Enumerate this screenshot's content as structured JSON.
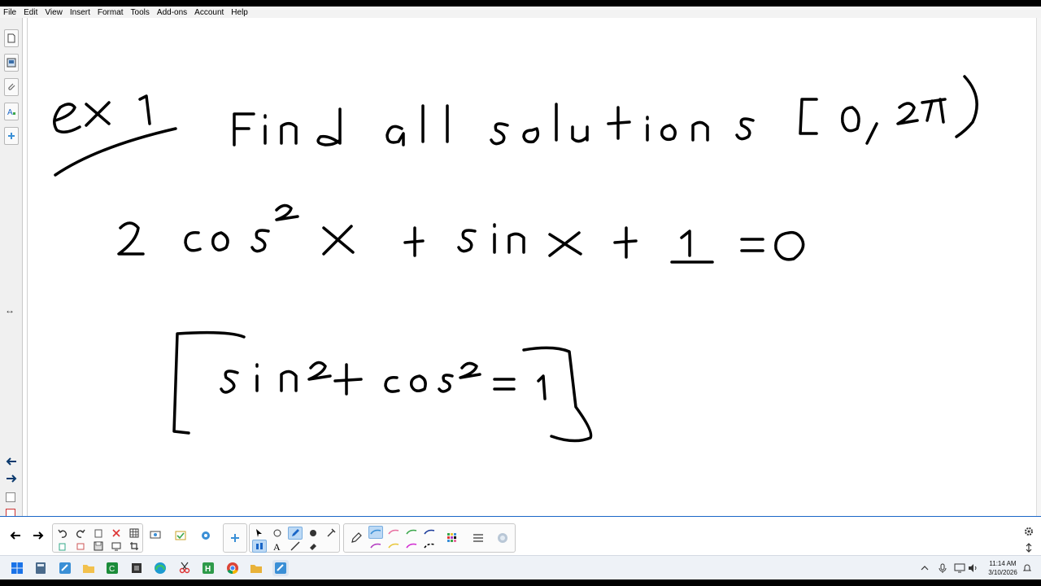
{
  "menu": {
    "items": [
      "File",
      "Edit",
      "View",
      "Insert",
      "Format",
      "Tools",
      "Add-ons",
      "Account",
      "Help"
    ]
  },
  "sidebar": {
    "tabs": [
      "page-sorter-icon",
      "gallery-icon",
      "attachments-icon",
      "properties-icon",
      "add-ons-icon"
    ],
    "splitter_glyph": "↔"
  },
  "board": {
    "label": "ex 1",
    "instruction": "Find all solutions",
    "interval": "[0, 2π)",
    "equation": "2 cos² x + sin x + 1 = 0",
    "identity": "sin² + cos² = 1"
  },
  "toolbar": {
    "tools": [
      "previous-page",
      "next-page",
      "undo",
      "redo",
      "delete",
      "table",
      "screen-capture",
      "select",
      "pen",
      "eraser",
      "line",
      "text",
      "fill"
    ],
    "colors": {
      "accent": "#1a66c7",
      "ink": "#000000",
      "pen_blue": "#3a8fd6",
      "pen_pink": "#e86fa0",
      "pen_yellow": "#e8c63a",
      "pen_green": "#3aa64a",
      "pen_purple": "#b23ac0"
    }
  },
  "taskbar": {
    "time": "11:14 AM",
    "date": "3/10/2026"
  }
}
